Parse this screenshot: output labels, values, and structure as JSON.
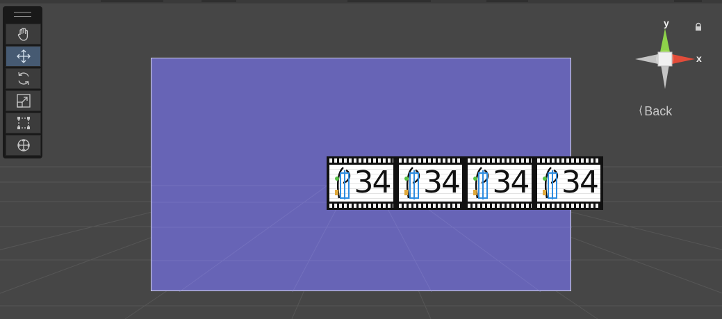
{
  "scene_view": {
    "background_color": "#464646",
    "canvas_color": "#6764b6"
  },
  "toolbar": {
    "tools": [
      {
        "name": "hand-tool-icon",
        "active": false
      },
      {
        "name": "move-tool-icon",
        "active": true
      },
      {
        "name": "rotate-tool-icon",
        "active": false
      },
      {
        "name": "scale-tool-icon",
        "active": false
      },
      {
        "name": "rect-tool-icon",
        "active": false
      },
      {
        "name": "transform-tool-icon",
        "active": false
      }
    ]
  },
  "filmstrip": {
    "frames": [
      {
        "label": "34"
      },
      {
        "label": "34"
      },
      {
        "label": "34"
      },
      {
        "label": "34"
      }
    ]
  },
  "orientation_gizmo": {
    "y_label": "y",
    "x_label": "x",
    "view_label": "Back",
    "colors": {
      "x": "#e24c3a",
      "y": "#8ed34a",
      "neutral": "#c8c8c8"
    }
  }
}
